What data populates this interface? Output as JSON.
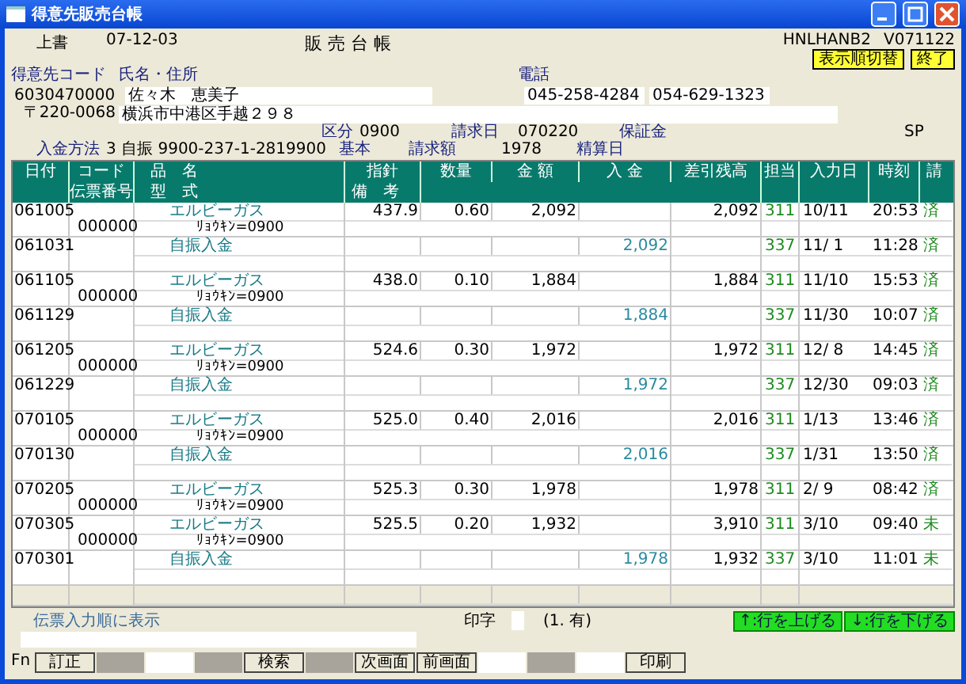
{
  "window": {
    "title": "得意先販売台帳"
  },
  "header": {
    "mode": "上書",
    "date": "07-12-03",
    "title": "販 売 台 帳",
    "program": "HNLHANB2",
    "version": "V071122",
    "buttons": [
      "表示順切替",
      "終了"
    ]
  },
  "customer": {
    "code_label": "得意先コード",
    "name_label": "氏名・住所",
    "phone_label": "電話",
    "code": "6030470000",
    "name": "佐々木　恵美子",
    "postal": "〒220-0068",
    "address": "横浜市中港区手越２９８",
    "phones": [
      "045-258-4284",
      "054-629-1323"
    ]
  },
  "info": {
    "category_label": "区分",
    "category": "0900",
    "billing_day_label": "請求日",
    "billing_day": "070220",
    "deposit_label": "保証金",
    "sp": "SP",
    "payment_method_label": "入金方法",
    "payment_method": "3 自振 9900-237-1-2819900",
    "basic_label": "基本",
    "billing_amount_label": "請求額",
    "billing_amount": "1978",
    "settlement_day_label": "精算日"
  },
  "table": {
    "columns": [
      "日付",
      "コード",
      "品　名",
      "指針",
      "数量",
      "金 額",
      "入 金",
      "差引残高",
      "担当",
      "入力日",
      "時刻",
      "請"
    ],
    "subcolumns": [
      "伝票番号",
      "型　式",
      "備　考"
    ],
    "rows": [
      {
        "date": "061005",
        "slip": "000000",
        "item": "エルビーガス",
        "note": "ﾘｮｳｷﾝ=0900",
        "meter": "437.9",
        "qty": "0.60",
        "amount": "2,092",
        "balance": "2,092",
        "staff": "311",
        "entry_date": "10/11",
        "time": "20:53",
        "status": "済"
      },
      {
        "date": "061031",
        "item": "自振入金",
        "payment": "2,092",
        "staff": "337",
        "entry_date": "11/ 1",
        "time": "11:28",
        "status": "済"
      },
      {
        "date": "061105",
        "slip": "000000",
        "item": "エルビーガス",
        "note": "ﾘｮｳｷﾝ=0900",
        "meter": "438.0",
        "qty": "0.10",
        "amount": "1,884",
        "balance": "1,884",
        "staff": "311",
        "entry_date": "11/10",
        "time": "15:53",
        "status": "済"
      },
      {
        "date": "061129",
        "item": "自振入金",
        "payment": "1,884",
        "staff": "337",
        "entry_date": "11/30",
        "time": "10:07",
        "status": "済"
      },
      {
        "date": "061205",
        "slip": "000000",
        "item": "エルビーガス",
        "note": "ﾘｮｳｷﾝ=0900",
        "meter": "524.6",
        "qty": "0.30",
        "amount": "1,972",
        "balance": "1,972",
        "staff": "311",
        "entry_date": "12/ 8",
        "time": "14:45",
        "status": "済"
      },
      {
        "date": "061229",
        "item": "自振入金",
        "payment": "1,972",
        "staff": "337",
        "entry_date": "12/30",
        "time": "09:03",
        "status": "済"
      },
      {
        "date": "070105",
        "slip": "000000",
        "item": "エルビーガス",
        "note": "ﾘｮｳｷﾝ=0900",
        "meter": "525.0",
        "qty": "0.40",
        "amount": "2,016",
        "balance": "2,016",
        "staff": "311",
        "entry_date": "1/13",
        "time": "13:46",
        "status": "済"
      },
      {
        "date": "070130",
        "item": "自振入金",
        "payment": "2,016",
        "staff": "337",
        "entry_date": "1/31",
        "time": "13:50",
        "status": "済"
      },
      {
        "date": "070205",
        "slip": "000000",
        "item": "エルビーガス",
        "note": "ﾘｮｳｷﾝ=0900",
        "meter": "525.3",
        "qty": "0.30",
        "amount": "1,978",
        "balance": "1,978",
        "staff": "311",
        "entry_date": "2/ 9",
        "time": "08:42",
        "status": "済"
      },
      {
        "date": "070305",
        "slip": "000000",
        "item": "エルビーガス",
        "note": "ﾘｮｳｷﾝ=0900",
        "meter": "525.5",
        "qty": "0.20",
        "amount": "1,932",
        "balance": "3,910",
        "staff": "311",
        "entry_date": "3/10",
        "time": "09:40",
        "status": "未"
      },
      {
        "date": "070301",
        "item": "自振入金",
        "payment": "1,978",
        "balance": "1,932",
        "staff": "337",
        "entry_date": "3/10",
        "time": "11:01",
        "status": "未"
      }
    ]
  },
  "footer": {
    "order_note": "伝票入力順に表示",
    "print_label": "印字",
    "print_hint": "(1. 有)",
    "row_buttons": [
      "↑:行を上げる",
      "↓:行を下げる"
    ]
  },
  "function_keys": {
    "label": "Fn",
    "keys": [
      {
        "label": "訂正",
        "kind": "button"
      },
      {
        "kind": "gray"
      },
      {
        "kind": "white"
      },
      {
        "kind": "gray"
      },
      {
        "label": "検索",
        "kind": "button"
      },
      {
        "kind": "gray"
      },
      {
        "label": "次画面",
        "kind": "button"
      },
      {
        "label": "前画面",
        "kind": "button"
      },
      {
        "kind": "white"
      },
      {
        "kind": "gray"
      },
      {
        "kind": "white"
      },
      {
        "label": "印刷",
        "kind": "button"
      }
    ]
  }
}
